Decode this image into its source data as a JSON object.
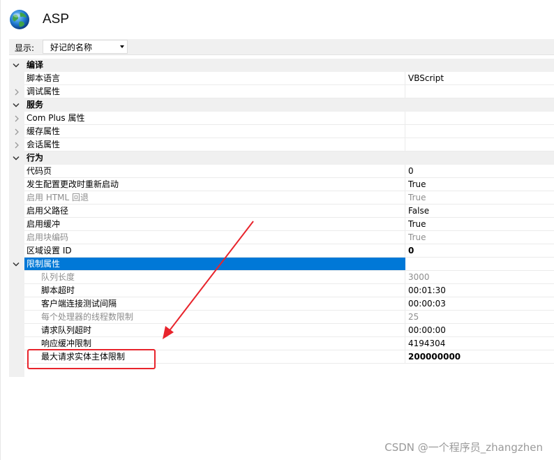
{
  "header": {
    "title": "ASP"
  },
  "toolbar": {
    "display_label": "显示:",
    "display_value": "好记的名称"
  },
  "grid": {
    "rows": [
      {
        "type": "category",
        "name": "编译",
        "expanded": true
      },
      {
        "type": "prop",
        "name": "脚本语言",
        "value": "VBScript"
      },
      {
        "type": "group",
        "name": "调试属性",
        "expanded": false
      },
      {
        "type": "category",
        "name": "服务",
        "expanded": true
      },
      {
        "type": "group",
        "name": "Com Plus 属性",
        "expanded": false
      },
      {
        "type": "group",
        "name": "缓存属性",
        "expanded": false
      },
      {
        "type": "group",
        "name": "会话属性",
        "expanded": false
      },
      {
        "type": "category",
        "name": "行为",
        "expanded": true
      },
      {
        "type": "prop",
        "name": "代码页",
        "value": "0"
      },
      {
        "type": "prop",
        "name": "发生配置更改时重新启动",
        "value": "True"
      },
      {
        "type": "prop",
        "name": "启用 HTML 回退",
        "value": "True",
        "disabled": true
      },
      {
        "type": "prop",
        "name": "启用父路径",
        "value": "False"
      },
      {
        "type": "prop",
        "name": "启用缓冲",
        "value": "True"
      },
      {
        "type": "prop",
        "name": "启用块编码",
        "value": "True",
        "disabled": true
      },
      {
        "type": "prop",
        "name": "区域设置 ID",
        "value": "0",
        "bold": true
      },
      {
        "type": "group",
        "name": "限制属性",
        "expanded": true,
        "selected": true
      },
      {
        "type": "child",
        "name": "队列长度",
        "value": "3000",
        "disabled": true
      },
      {
        "type": "child",
        "name": "脚本超时",
        "value": "00:01:30"
      },
      {
        "type": "child",
        "name": "客户端连接测试间隔",
        "value": "00:00:03"
      },
      {
        "type": "child",
        "name": "每个处理器的线程数限制",
        "value": "25",
        "disabled": true
      },
      {
        "type": "child",
        "name": "请求队列超时",
        "value": "00:00:00"
      },
      {
        "type": "child",
        "name": "响应缓冲限制",
        "value": "4194304"
      },
      {
        "type": "child",
        "name": "最大请求实体主体限制",
        "value": "200000000",
        "bold": true
      }
    ]
  },
  "watermark": "CSDN @一个程序员_zhangzhen",
  "colors": {
    "selection": "#0078d7",
    "annotation": "#e8242c",
    "category_bg": "#f0f0f0"
  }
}
